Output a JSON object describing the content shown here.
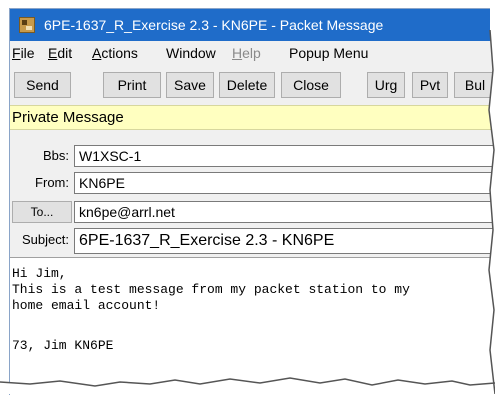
{
  "window": {
    "title": "6PE-1637_R_Exercise 2.3 - KN6PE - Packet Message",
    "icon": "packet-app-icon"
  },
  "menubar": [
    {
      "label": "File",
      "mnemonic": "F",
      "rest": "ile"
    },
    {
      "label": "Edit",
      "mnemonic": "E",
      "rest": "dit"
    },
    {
      "label": "Actions",
      "mnemonic": "A",
      "rest": "ctions"
    },
    {
      "label": "Window",
      "mnemonic": "",
      "rest": "Window"
    },
    {
      "label": "Help",
      "mnemonic": "H",
      "rest": "elp",
      "disabled": true
    },
    {
      "label": "Popup Menu",
      "mnemonic": "",
      "rest": "Popup Menu"
    }
  ],
  "toolbar": {
    "send": "Send",
    "print": "Print",
    "save": "Save",
    "delete": "Delete",
    "close": "Close",
    "urg": "Urg",
    "pvt": "Pvt",
    "bul": "Bul"
  },
  "banner": {
    "text": "Private Message",
    "color": "#ffffc0"
  },
  "header": {
    "bbs_label": "Bbs:",
    "bbs_value": "W1XSC-1",
    "from_label": "From:",
    "from_value": "KN6PE",
    "to_button": "To...",
    "to_value": "kn6pe@arrl.net",
    "subject_label": "Subject:",
    "subject_value": "6PE-1637_R_Exercise 2.3 - KN6PE"
  },
  "body": {
    "lines": [
      "Hi Jim,",
      "This is a test message from my packet station to my",
      "home email account!",
      "",
      "73, Jim KN6PE"
    ]
  },
  "colors": {
    "titlebar": "#1f6cc9",
    "window_bg": "#f0f0f0"
  }
}
